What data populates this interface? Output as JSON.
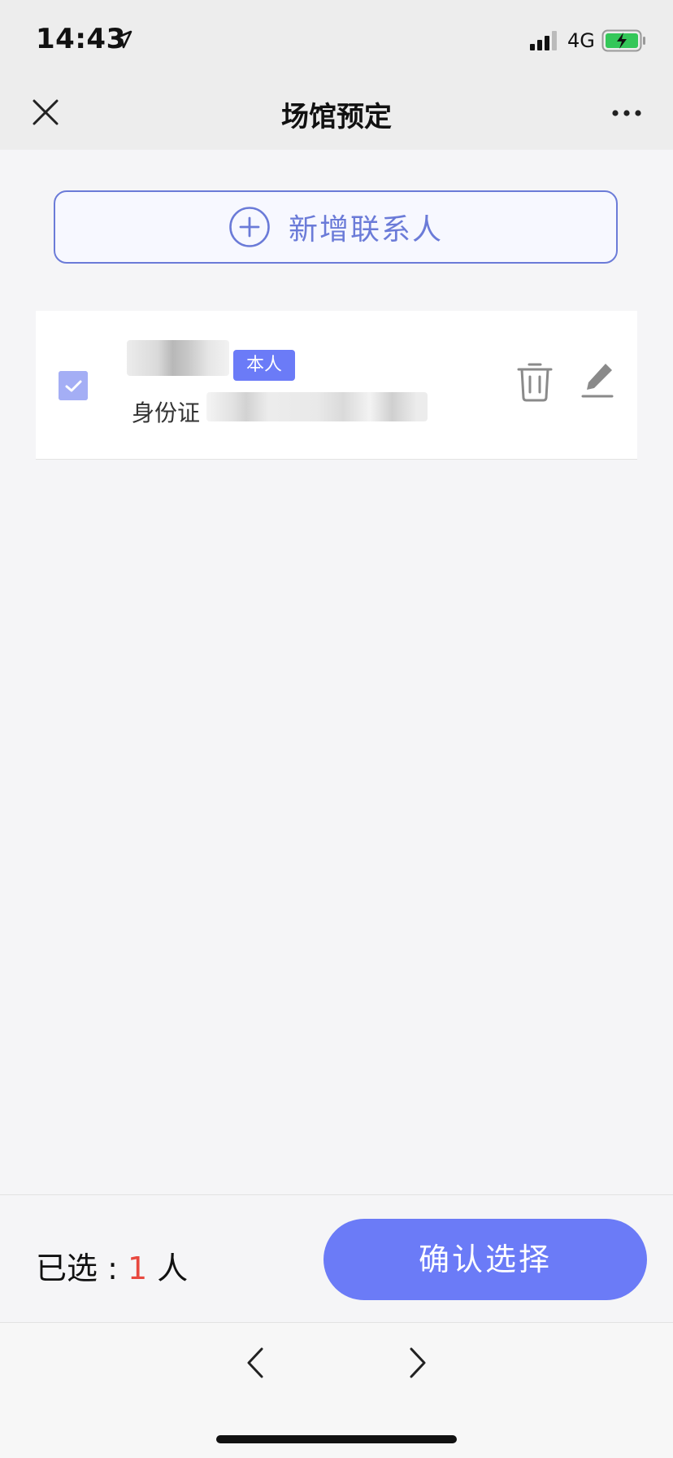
{
  "status_bar": {
    "time": "14:43",
    "network": "4G",
    "icons": [
      "location-arrow-icon",
      "signal-bars-icon",
      "battery-charging-icon"
    ]
  },
  "header": {
    "title": "场馆预定",
    "icons": [
      "close-icon",
      "more-icon"
    ]
  },
  "add_contact": {
    "label": "新增联系人",
    "icon": "plus-circle-icon"
  },
  "contacts": [
    {
      "name": "",
      "badge": "本人",
      "id_label": "身份证",
      "id_number": "",
      "checked": true,
      "icons": [
        "checkbox-checked-icon",
        "trash-icon",
        "pencil-icon"
      ]
    }
  ],
  "footer": {
    "selected_prefix": "已选 : ",
    "selected_count": "1",
    "selected_suffix": " 人",
    "confirm_label": "确认选择"
  },
  "browser_toolbar": {
    "icons": [
      "back-arrow-icon",
      "forward-arrow-icon"
    ]
  },
  "colors": {
    "accent": "#6b7bf7",
    "accent_outline": "#6b7bd8",
    "count_highlight": "#e8483f",
    "checkbox": "#a4aef5"
  }
}
